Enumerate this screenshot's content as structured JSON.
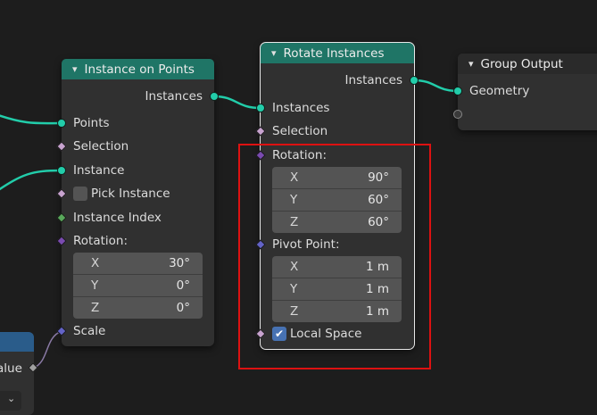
{
  "nodes": {
    "instance_on_points": {
      "title": "Instance on Points",
      "output_instances": "Instances",
      "inputs": {
        "points": "Points",
        "selection": "Selection",
        "instance": "Instance",
        "pick_instance": "Pick Instance",
        "instance_index": "Instance Index",
        "rotation": "Rotation:",
        "scale": "Scale"
      },
      "rotation": {
        "x_label": "X",
        "x": "30°",
        "y_label": "Y",
        "y": "0°",
        "z_label": "Z",
        "z": "0°"
      }
    },
    "rotate_instances": {
      "title": "Rotate Instances",
      "output_instances": "Instances",
      "inputs": {
        "instances": "Instances",
        "selection": "Selection",
        "rotation": "Rotation:",
        "pivot_point": "Pivot Point:",
        "local_space": "Local Space"
      },
      "rotation": {
        "x_label": "X",
        "x": "90°",
        "y_label": "Y",
        "y": "60°",
        "z_label": "Z",
        "z": "60°"
      },
      "pivot": {
        "x_label": "X",
        "x": "1 m",
        "y_label": "Y",
        "y": "1 m",
        "z_label": "Z",
        "z": "1 m"
      },
      "local_space_checked": true
    },
    "group_output": {
      "title": "Group Output",
      "input_geometry": "Geometry"
    },
    "partial_left": {
      "label_fragment": "alue"
    }
  },
  "colors": {
    "geometry_socket": "#22cdaa",
    "node_header_geometry": "#1f7566",
    "selection_highlight": "#dd1111",
    "vector_socket": "#6363c7",
    "rotation_socket": "#7a4bb0",
    "field_socket": "#c8a3cf",
    "integer_socket": "#59a85b"
  },
  "icons": {
    "collapse": "chevron-down-icon",
    "checkbox_checked": "checkmark-icon",
    "dropdown": "chevron-down-icon"
  }
}
